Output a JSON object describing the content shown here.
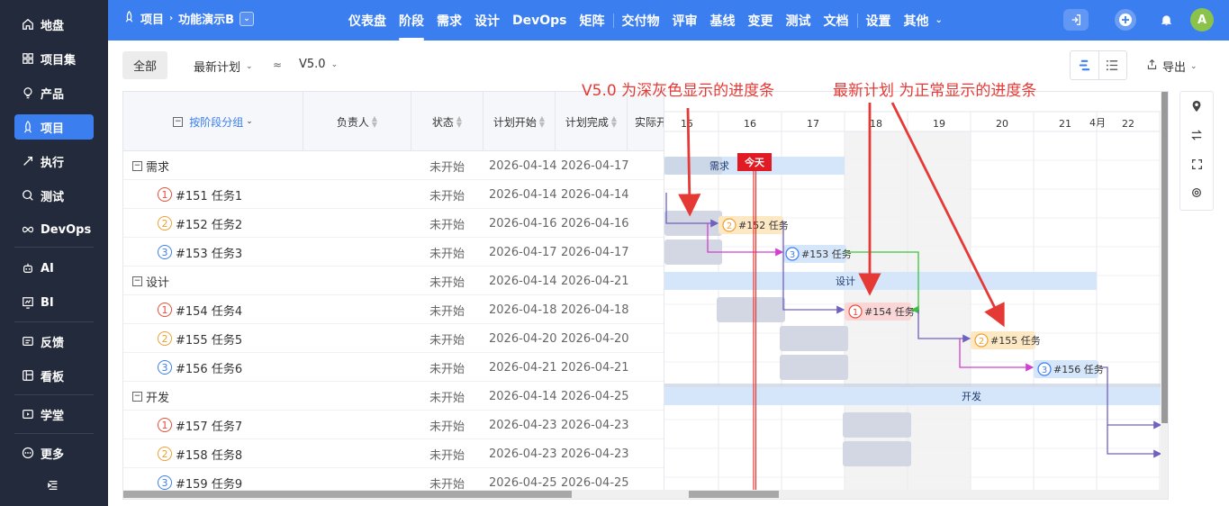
{
  "sidebar": {
    "items": [
      {
        "label": "地盘",
        "icon": "home-icon"
      },
      {
        "label": "项目集",
        "icon": "grid-icon"
      },
      {
        "label": "产品",
        "icon": "bulb-icon"
      },
      {
        "label": "项目",
        "icon": "rocket-icon",
        "active": true
      },
      {
        "label": "执行",
        "icon": "run-icon"
      },
      {
        "label": "测试",
        "icon": "search-icon"
      },
      {
        "label": "DevOps",
        "icon": "infinity-icon"
      },
      {
        "label": "AI",
        "icon": "robot-icon"
      },
      {
        "label": "BI",
        "icon": "chart-icon"
      },
      {
        "label": "反馈",
        "icon": "feedback-icon"
      },
      {
        "label": "看板",
        "icon": "board-icon"
      },
      {
        "label": "学堂",
        "icon": "school-icon"
      },
      {
        "label": "更多",
        "icon": "more-icon"
      }
    ]
  },
  "topbar": {
    "crumb_project": "项目",
    "crumb_current": "功能演示B",
    "nav": [
      "仪表盘",
      "阶段",
      "需求",
      "设计",
      "DevOps",
      "矩阵",
      "交付物",
      "评审",
      "基线",
      "变更",
      "测试",
      "文档",
      "设置",
      "其他"
    ],
    "nav_active": "阶段",
    "avatar": "A"
  },
  "toolbar": {
    "tab_all": "全部",
    "plan_select": "最新计划",
    "version_select": "V5.0",
    "export": "导出"
  },
  "table": {
    "headers": {
      "group": "按阶段分组",
      "owner": "负责人",
      "status": "状态",
      "plan_start": "计划开始",
      "plan_end": "计划完成",
      "actual": "实际开"
    },
    "rows": [
      {
        "type": "group",
        "name": "需求",
        "status": "未开始",
        "start": "2026-04-14",
        "end": "2026-04-17"
      },
      {
        "type": "task",
        "prio": "1",
        "name": "#151 任务1",
        "status": "未开始",
        "start": "2026-04-14",
        "end": "2026-04-14"
      },
      {
        "type": "task",
        "prio": "2",
        "name": "#152 任务2",
        "status": "未开始",
        "start": "2026-04-16",
        "end": "2026-04-16"
      },
      {
        "type": "task",
        "prio": "3",
        "name": "#153 任务3",
        "status": "未开始",
        "start": "2026-04-17",
        "end": "2026-04-17"
      },
      {
        "type": "group",
        "name": "设计",
        "status": "未开始",
        "start": "2026-04-14",
        "end": "2026-04-21"
      },
      {
        "type": "task",
        "prio": "1",
        "name": "#154 任务4",
        "status": "未开始",
        "start": "2026-04-18",
        "end": "2026-04-18"
      },
      {
        "type": "task",
        "prio": "2",
        "name": "#155 任务5",
        "status": "未开始",
        "start": "2026-04-20",
        "end": "2026-04-20"
      },
      {
        "type": "task",
        "prio": "3",
        "name": "#156 任务6",
        "status": "未开始",
        "start": "2026-04-21",
        "end": "2026-04-21"
      },
      {
        "type": "group",
        "name": "开发",
        "status": "未开始",
        "start": "2026-04-14",
        "end": "2026-04-25"
      },
      {
        "type": "task",
        "prio": "1",
        "name": "#157 任务7",
        "status": "未开始",
        "start": "2026-04-23",
        "end": "2026-04-23"
      },
      {
        "type": "task",
        "prio": "2",
        "name": "#158 任务8",
        "status": "未开始",
        "start": "2026-04-23",
        "end": "2026-04-23"
      },
      {
        "type": "task",
        "prio": "3",
        "name": "#159 任务9",
        "status": "未开始",
        "start": "2026-04-25",
        "end": "2026-04-25"
      }
    ]
  },
  "gantt": {
    "month": "4月",
    "days": [
      "15",
      "16",
      "17",
      "18",
      "19",
      "20",
      "21",
      "22"
    ],
    "today_label": "今天",
    "bars": {
      "req": "需求",
      "design": "设计",
      "dev": "开发",
      "t152": "#152 任务",
      "t153": "#153 任务",
      "t154": "#154 任务",
      "t155": "#155 任务",
      "t156": "#156 任务"
    },
    "prio_digits": {
      "t152": "2",
      "t153": "3",
      "t154": "1",
      "t155": "2",
      "t156": "3"
    }
  },
  "annotations": {
    "left": "V5.0 为深灰色显示的进度条",
    "right": "最新计划 为正常显示的进度条"
  },
  "colors": {
    "brand": "#3b7ef0",
    "sidebar": "#232a3b",
    "annotation": "#e53935"
  }
}
